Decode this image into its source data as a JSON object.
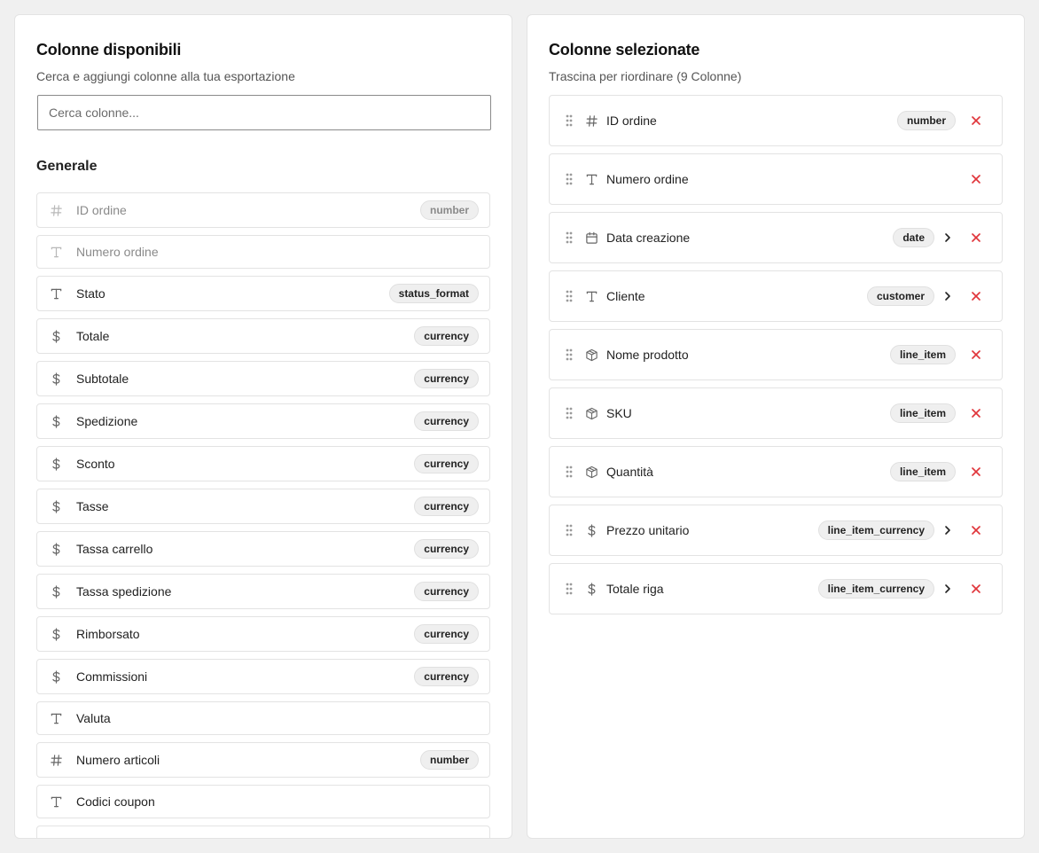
{
  "available": {
    "title": "Colonne disponibili",
    "subtitle": "Cerca e aggiungi colonne alla tua esportazione",
    "search": {
      "placeholder": "Cerca colonne...",
      "value": ""
    },
    "section": "Generale",
    "items": [
      {
        "icon": "hash-icon",
        "label": "ID ordine",
        "badge": "number",
        "dim": true
      },
      {
        "icon": "text-icon",
        "label": "Numero ordine",
        "badge": "",
        "dim": true
      },
      {
        "icon": "text-icon",
        "label": "Stato",
        "badge": "status_format",
        "dim": false
      },
      {
        "icon": "dollar-icon",
        "label": "Totale",
        "badge": "currency",
        "dim": false
      },
      {
        "icon": "dollar-icon",
        "label": "Subtotale",
        "badge": "currency",
        "dim": false
      },
      {
        "icon": "dollar-icon",
        "label": "Spedizione",
        "badge": "currency",
        "dim": false
      },
      {
        "icon": "dollar-icon",
        "label": "Sconto",
        "badge": "currency",
        "dim": false
      },
      {
        "icon": "dollar-icon",
        "label": "Tasse",
        "badge": "currency",
        "dim": false
      },
      {
        "icon": "dollar-icon",
        "label": "Tassa carrello",
        "badge": "currency",
        "dim": false
      },
      {
        "icon": "dollar-icon",
        "label": "Tassa spedizione",
        "badge": "currency",
        "dim": false
      },
      {
        "icon": "dollar-icon",
        "label": "Rimborsato",
        "badge": "currency",
        "dim": false
      },
      {
        "icon": "dollar-icon",
        "label": "Commissioni",
        "badge": "currency",
        "dim": false
      },
      {
        "icon": "text-icon",
        "label": "Valuta",
        "badge": "",
        "dim": false
      },
      {
        "icon": "hash-icon",
        "label": "Numero articoli",
        "badge": "number",
        "dim": false
      },
      {
        "icon": "text-icon",
        "label": "Codici coupon",
        "badge": "",
        "dim": false
      },
      {
        "icon": "text-icon",
        "label": "",
        "badge": "",
        "dim": false
      }
    ]
  },
  "selected": {
    "title": "Colonne selezionate",
    "subtitle": "Trascina per riordinare (9 Colonne)",
    "items": [
      {
        "icon": "hash-icon",
        "label": "ID ordine",
        "badge": "number",
        "chevron": false
      },
      {
        "icon": "text-icon",
        "label": "Numero ordine",
        "badge": "",
        "chevron": false
      },
      {
        "icon": "calendar-icon",
        "label": "Data creazione",
        "badge": "date",
        "chevron": true
      },
      {
        "icon": "text-icon",
        "label": "Cliente",
        "badge": "customer",
        "chevron": true
      },
      {
        "icon": "box-icon",
        "label": "Nome prodotto",
        "badge": "line_item",
        "chevron": false
      },
      {
        "icon": "box-icon",
        "label": "SKU",
        "badge": "line_item",
        "chevron": false
      },
      {
        "icon": "box-icon",
        "label": "Quantità",
        "badge": "line_item",
        "chevron": false
      },
      {
        "icon": "dollar-icon",
        "label": "Prezzo unitario",
        "badge": "line_item_currency",
        "chevron": true
      },
      {
        "icon": "dollar-icon",
        "label": "Totale riga",
        "badge": "line_item_currency",
        "chevron": true
      }
    ]
  },
  "colors": {
    "remove": "#e0353b",
    "badge_bg": "#efefef",
    "border": "#e3e3e3"
  }
}
